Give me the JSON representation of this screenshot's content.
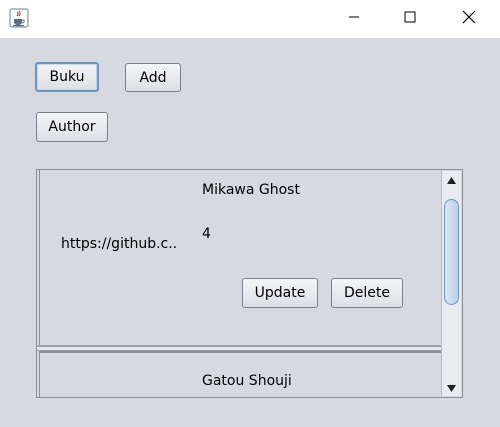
{
  "window": {
    "icons": {
      "app": "java-cup-icon",
      "minimize": "minimize-icon",
      "maximize": "maximize-icon",
      "close": "close-icon"
    }
  },
  "buttons": {
    "buku": "Buku",
    "add": "Add",
    "author": "Author"
  },
  "list": {
    "items": [
      {
        "title": "Mikawa Ghost",
        "url": "https://github.c..",
        "count": "4",
        "update": "Update",
        "delete": "Delete"
      },
      {
        "title": "Gatou Shouji"
      }
    ]
  },
  "colors": {
    "background": "#d6d9df",
    "focus_border": "#6e94c2"
  }
}
